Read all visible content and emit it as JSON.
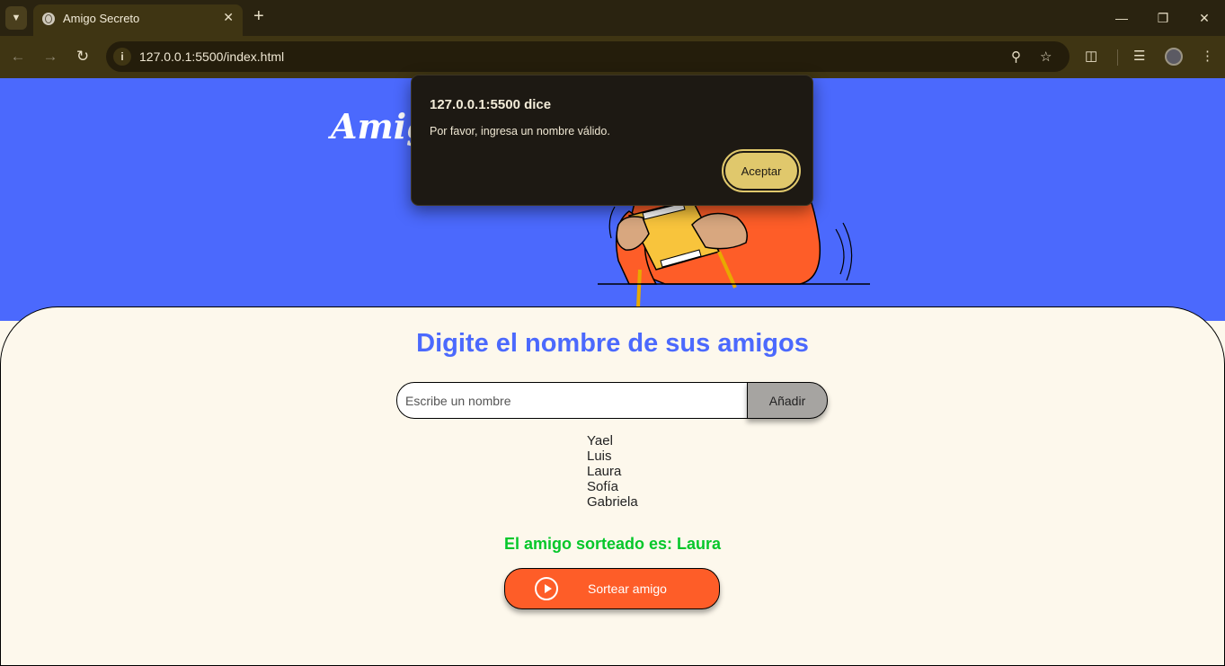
{
  "browser": {
    "tab_title": "Amigo Secreto",
    "url": "127.0.0.1:5500/index.html"
  },
  "page": {
    "hero_title": "Amigo Secreto",
    "section_title": "Digite el nombre de sus amigos",
    "input_placeholder": "Escribe un nombre",
    "add_button": "Añadir",
    "friends": [
      "Yael",
      "Luis",
      "Laura",
      "Sofía",
      "Gabriela"
    ],
    "result": "El amigo sorteado es: Laura",
    "draw_button": "Sortear amigo"
  },
  "dialog": {
    "title": "127.0.0.1:5500 dice",
    "message": "Por favor, ingresa un nombre válido.",
    "accept": "Aceptar"
  },
  "colors": {
    "hero_bg": "#4b69fd",
    "page_bg": "#fdf8ec",
    "accent_blue": "#4b69fd",
    "result_green": "#05c72a",
    "button_orange": "#fe5d28",
    "dialog_button": "#e0c86c"
  }
}
